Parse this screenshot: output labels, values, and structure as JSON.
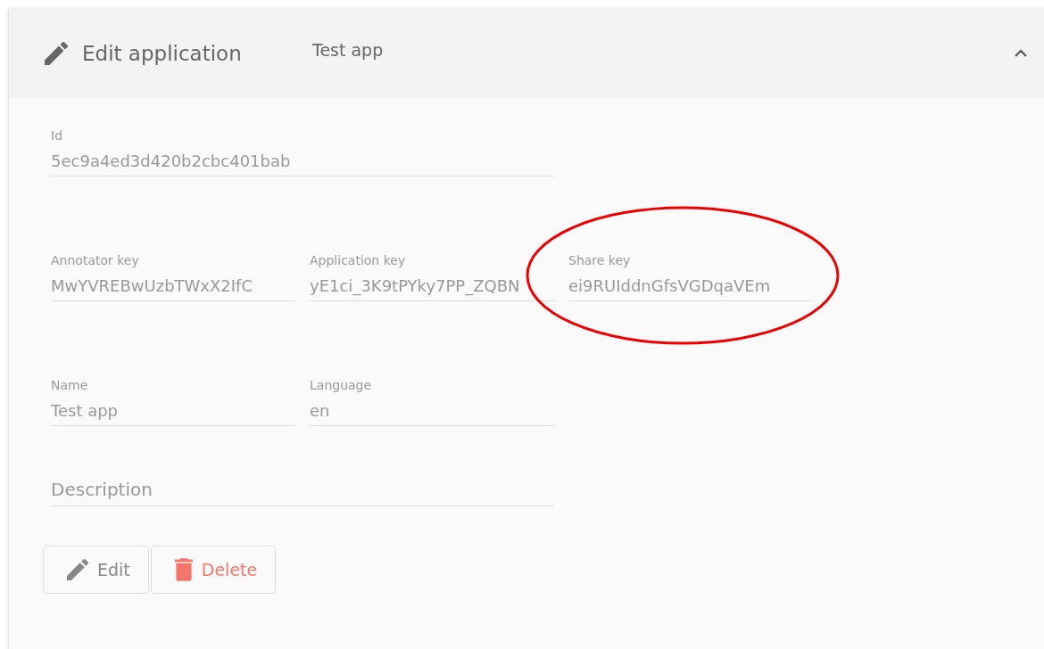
{
  "header": {
    "title": "Edit application",
    "subtitle": "Test app",
    "expanded": true
  },
  "rows": [
    {
      "fields": [
        {
          "label": "Id",
          "value": "5ec9a4ed3d420b2cbc401bab",
          "wide": true
        }
      ]
    },
    {
      "fields": [
        {
          "label": "Annotator key",
          "value": "MwYVREBwUzbTWxX2IfC"
        },
        {
          "label": "Application key",
          "value": "yE1ci_3K9tPYky7PP_ZQBN"
        },
        {
          "label": "Share key",
          "value": "ei9RUIddnGfsVGDqaVEm",
          "circled": true
        }
      ]
    },
    {
      "fields": [
        {
          "label": "Name",
          "value": "Test app"
        },
        {
          "label": "Language",
          "value": "en"
        }
      ]
    },
    {
      "fields": [
        {
          "placeholder": "Description",
          "wide": true
        }
      ]
    }
  ],
  "buttons": [
    {
      "label": "Edit",
      "kind": "edit"
    },
    {
      "label": "Delete",
      "kind": "delete"
    }
  ]
}
